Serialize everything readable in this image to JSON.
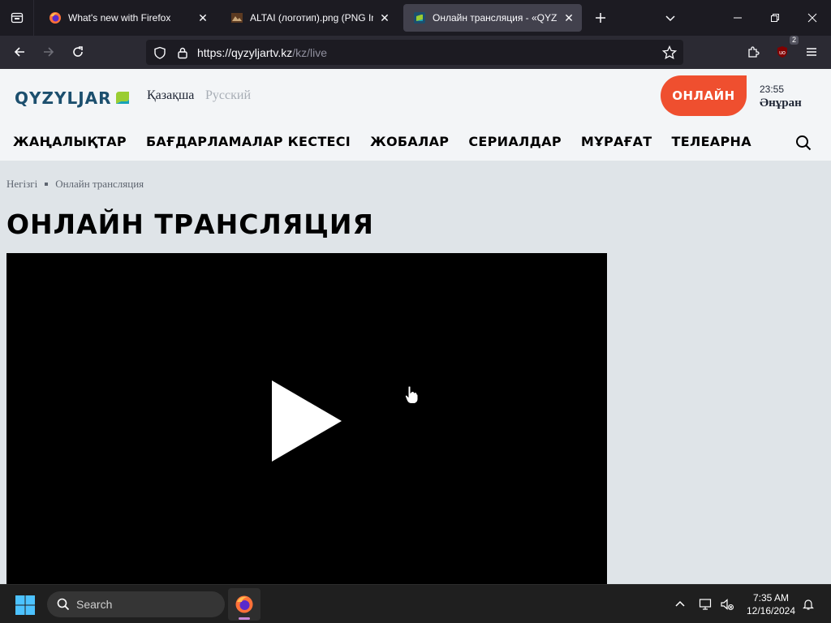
{
  "browser": {
    "tabs": [
      {
        "title": "What's new with Firefox",
        "active": false
      },
      {
        "title": "ALTAI (логотип).png (PNG Ima",
        "active": false
      },
      {
        "title": "Онлайн трансляция - «QYZYL",
        "active": true
      }
    ],
    "url": {
      "host": "https://qyzyljartv.kz",
      "path": "/kz/live"
    },
    "extension_badge": "2"
  },
  "site": {
    "logo_text": "QYZYLJAR",
    "languages": {
      "kz": "Қазақша",
      "ru": "Русский"
    },
    "online_button": "ОНЛАЙН",
    "now_playing": {
      "time": "23:55",
      "title": "Әнұран"
    },
    "nav": [
      "ЖАҢАЛЫҚТАР",
      "БАҒДАРЛАМАЛАР КЕСТЕСІ",
      "ЖОБАЛАР",
      "СЕРИАЛДАР",
      "МҰРАҒАТ",
      "ТЕЛЕАРНА"
    ],
    "breadcrumb": {
      "home": "Негізгі",
      "current": "Онлайн трансляция"
    },
    "page_title": "ОНЛАЙН ТРАНСЛЯЦИЯ",
    "colors": {
      "accent": "#ef4f2f",
      "logo": "#1c4f6e",
      "logo_green": "#9acd32",
      "logo_teal": "#17a2b8"
    }
  },
  "taskbar": {
    "search_label": "Search",
    "time": "7:35 AM",
    "date": "12/16/2024"
  }
}
